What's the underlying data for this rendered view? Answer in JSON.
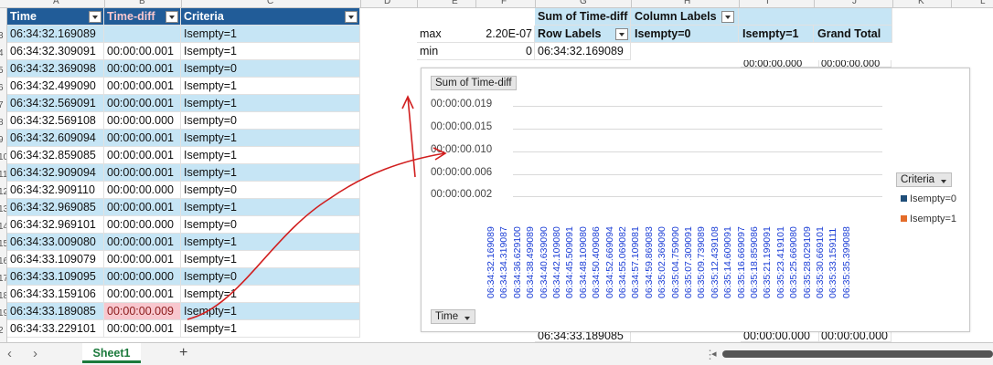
{
  "column_letters": [
    "A",
    "B",
    "C",
    "D",
    "E",
    "F",
    "G",
    "H",
    "I",
    "J",
    "K",
    "L"
  ],
  "row_numbers": [
    "2",
    "3",
    "4",
    "5",
    "6",
    "7",
    "8",
    "9",
    "10",
    "11",
    "12",
    "13",
    "14",
    "15",
    "16",
    "17",
    "18",
    "19"
  ],
  "table": {
    "headers": [
      "Time",
      "Time-diff",
      "Criteria"
    ],
    "rows": [
      [
        "06:34:32.169089",
        "",
        "Isempty=1"
      ],
      [
        "06:34:32.309091",
        "00:00:00.001",
        "Isempty=1"
      ],
      [
        "06:34:32.369098",
        "00:00:00.001",
        "Isempty=0"
      ],
      [
        "06:34:32.499090",
        "00:00:00.001",
        "Isempty=1"
      ],
      [
        "06:34:32.569091",
        "00:00:00.001",
        "Isempty=1"
      ],
      [
        "06:34:32.569108",
        "00:00:00.000",
        "Isempty=0"
      ],
      [
        "06:34:32.609094",
        "00:00:00.001",
        "Isempty=1"
      ],
      [
        "06:34:32.859085",
        "00:00:00.001",
        "Isempty=1"
      ],
      [
        "06:34:32.909094",
        "00:00:00.001",
        "Isempty=1"
      ],
      [
        "06:34:32.909110",
        "00:00:00.000",
        "Isempty=0"
      ],
      [
        "06:34:32.969085",
        "00:00:00.001",
        "Isempty=1"
      ],
      [
        "06:34:32.969101",
        "00:00:00.000",
        "Isempty=0"
      ],
      [
        "06:34:33.009080",
        "00:00:00.001",
        "Isempty=1"
      ],
      [
        "06:34:33.109079",
        "00:00:00.001",
        "Isempty=1"
      ],
      [
        "06:34:33.109095",
        "00:00:00.000",
        "Isempty=0"
      ],
      [
        "06:34:33.159106",
        "00:00:00.001",
        "Isempty=1"
      ],
      [
        "06:34:33.189085",
        "00:00:00.009",
        "Isempty=1"
      ],
      [
        "06:34:33.229101",
        "00:00:00.001",
        "Isempty=1"
      ]
    ]
  },
  "stats": {
    "max_label": "max",
    "max_value": "2.20E-07",
    "min_label": "min",
    "min_value": "0"
  },
  "pivot": {
    "value_header": "Sum of Time-diff",
    "column_labels": "Column Labels",
    "row_labels": "Row Labels",
    "col1": "Isempty=0",
    "col2": "Isempty=1",
    "grand_total": "Grand Total",
    "first_row_label": "06:34:32.169089",
    "partial_values": [
      "00:00:00.000",
      "00:00:00.000"
    ],
    "bottom_row_label": "06:34:33.189085",
    "bottom_values": [
      "00:00:00.000",
      "00:00:00.000"
    ]
  },
  "chart": {
    "value_button": "Sum of Time-diff",
    "axis_button": "Time",
    "legend_button": "Criteria"
  },
  "chart_data": {
    "type": "line",
    "yticks": [
      "00:00:00.019",
      "00:00:00.015",
      "00:00:00.010",
      "00:00:00.006",
      "00:00:00.002"
    ],
    "categories": [
      "06:34:32.169089",
      "06:34:34.319087",
      "06:34:36.629100",
      "06:34:38.499089",
      "06:34:40.639090",
      "06:34:42.109080",
      "06:34:45.509091",
      "06:34:48.109080",
      "06:34:50.409086",
      "06:34:52.669094",
      "06:34:55.069082",
      "06:34:57.109081",
      "06:34:59.869083",
      "06:35:02.369090",
      "06:35:04.759090",
      "06:35:07.309091",
      "06:35:09.739089",
      "06:35:12.439108",
      "06:35:14.609091",
      "06:35:16.669097",
      "06:35:18.859086",
      "06:35:21.199091",
      "06:35:23.419101",
      "06:35:25.669080",
      "06:35:28.029109",
      "06:35:30.669101",
      "06:35:33.159111",
      "06:35:35.399088"
    ],
    "series": [
      {
        "name": "Isempty=0",
        "color": "#1f4e79"
      },
      {
        "name": "Isempty=1",
        "color": "#e46c2a"
      }
    ]
  },
  "sheet": {
    "tab": "Sheet1",
    "add": "+"
  },
  "colors": {
    "header": "#215c98",
    "band": "#c6e5f5",
    "highlight": "#f8c7ce",
    "annotation": "#d11f1f"
  }
}
